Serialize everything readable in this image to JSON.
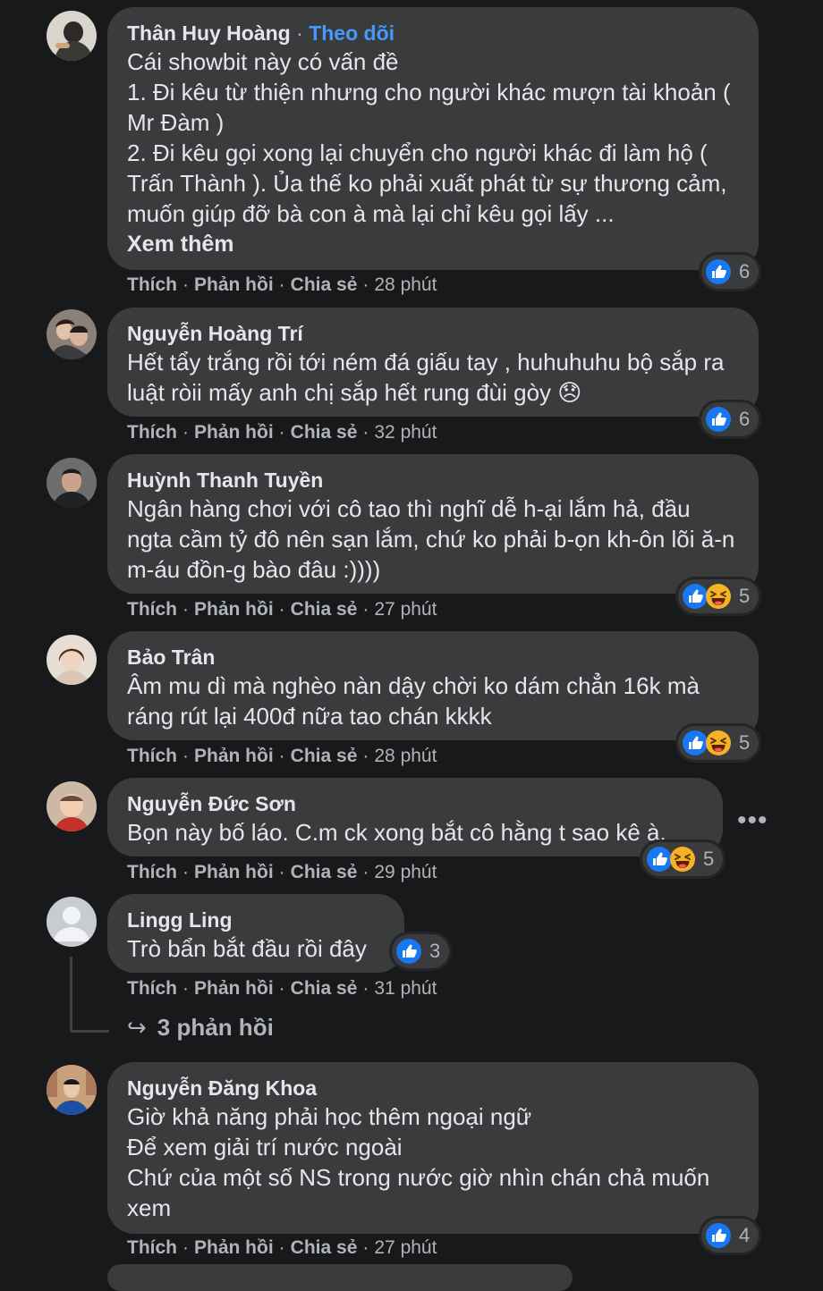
{
  "actions": {
    "like": "Thích",
    "reply": "Phản hồi",
    "share": "Chia sẻ",
    "separator": "·"
  },
  "icons": {
    "like": "like-reaction-icon",
    "haha": "haha-reaction-icon",
    "more": "more-options-icon",
    "reply_arrow": "reply-arrow-icon"
  },
  "colors": {
    "background": "#18191a",
    "bubble": "#3a3b3c",
    "text": "#e4e6eb",
    "secondary": "#b0b3b8",
    "link_blue": "#4599ff",
    "like_blue": "#1877f2",
    "haha_yellow": "#f7b125"
  },
  "comments": [
    {
      "author": "Thân Huy Hoàng",
      "follow": "Theo dõi",
      "text": "Cái showbit này có vấn đề\n1. Đi kêu từ thiện nhưng cho người khác mượn tài khoản ( Mr Đàm )\n2. Đi kêu gọi xong lại chuyển cho người khác đi làm hộ ( Trấn Thành ). Ủa thế ko phải xuất phát từ sự thương cảm, muốn giúp đỡ bà con à mà lại chỉ kêu gọi lấy ...",
      "see_more": "Xem thêm",
      "time": "28 phút",
      "reactions": [
        "like"
      ],
      "reaction_count": "6"
    },
    {
      "author": "Nguyễn Hoàng Trí",
      "text": "Hết tẩy trắng rồi tới ném đá giấu tay , huhuhuhu bộ sắp ra luật ròii mấy anh chị sắp hết rung đùi gòy 😞",
      "time": "32 phút",
      "reactions": [
        "like"
      ],
      "reaction_count": "6"
    },
    {
      "author": "Huỳnh Thanh Tuyền",
      "text": "Ngân hàng chơi với cô tao thì nghĩ dễ h-ại lắm hả, đầu ngta cầm tỷ đô nên sạn lắm, chứ ko phải b-ọn kh-ôn lõi ă-n m-áu đồn-g bào đâu :))))",
      "time": "27 phút",
      "reactions": [
        "like",
        "haha"
      ],
      "reaction_count": "5"
    },
    {
      "author": "Bảo Trân",
      "text": "Âm mu dì mà nghèo nàn dậy chời ko dám chẳn 16k mà ráng rút lại 400đ nữa tao chán kkkk",
      "time": "28 phút",
      "reactions": [
        "like",
        "haha"
      ],
      "reaction_count": "5"
    },
    {
      "author": "Nguyễn Đức Sơn",
      "text": "Bọn này bố láo. C.m ck xong bắt cô hằng t sao kê à.",
      "time": "29 phút",
      "reactions": [
        "like",
        "haha"
      ],
      "reaction_count": "5"
    },
    {
      "author": "Lingg Ling",
      "text": "Trò bẩn bắt đầu rồi đây",
      "time": "31 phút",
      "reactions": [
        "like"
      ],
      "reaction_count": "3",
      "replies_label": "3 phản hồi"
    },
    {
      "author": "Nguyễn Đăng Khoa",
      "text": "Giờ khả năng phải học thêm ngoại ngữ\nĐể xem giải trí nước ngoài\nChứ của một số NS trong nước giờ nhìn chán chả muốn xem",
      "time": "27 phút",
      "reactions": [
        "like"
      ],
      "reaction_count": "4"
    }
  ]
}
